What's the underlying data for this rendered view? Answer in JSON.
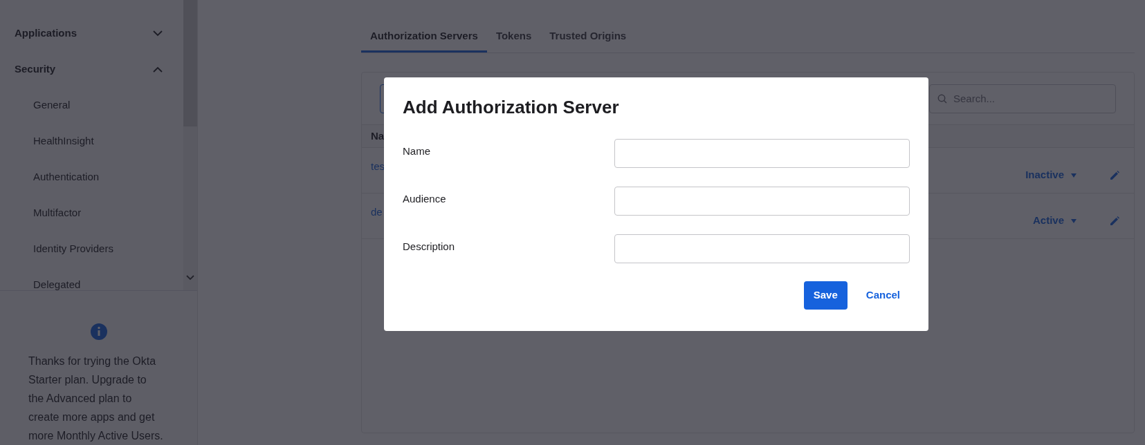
{
  "sidebar": {
    "nav": [
      {
        "label": "Applications",
        "expanded": false
      },
      {
        "label": "Security",
        "expanded": true,
        "children": [
          {
            "label": "General"
          },
          {
            "label": "HealthInsight"
          },
          {
            "label": "Authentication"
          },
          {
            "label": "Multifactor"
          },
          {
            "label": "Identity Providers"
          },
          {
            "label": "Delegated"
          }
        ]
      }
    ],
    "promo": {
      "text": "Thanks for trying the Okta Starter plan. Upgrade to the Advanced plan to create more apps and get more Monthly Active Users."
    }
  },
  "tabs": [
    {
      "label": "Authorization Servers",
      "selected": true
    },
    {
      "label": "Tokens",
      "selected": false
    },
    {
      "label": "Trusted Origins",
      "selected": false
    }
  ],
  "table": {
    "search": {
      "placeholder": "Search..."
    },
    "columns": [
      "Na"
    ],
    "rows": [
      {
        "name": "tes",
        "status": "Inactive"
      },
      {
        "name": "de",
        "status": "Active"
      }
    ]
  },
  "modal": {
    "title": "Add Authorization Server",
    "fields": [
      {
        "label": "Name"
      },
      {
        "label": "Audience"
      },
      {
        "label": "Description"
      }
    ],
    "buttons": [
      {
        "label": "Save",
        "kind": "primary"
      },
      {
        "label": "Cancel",
        "kind": "secondary"
      }
    ]
  }
}
